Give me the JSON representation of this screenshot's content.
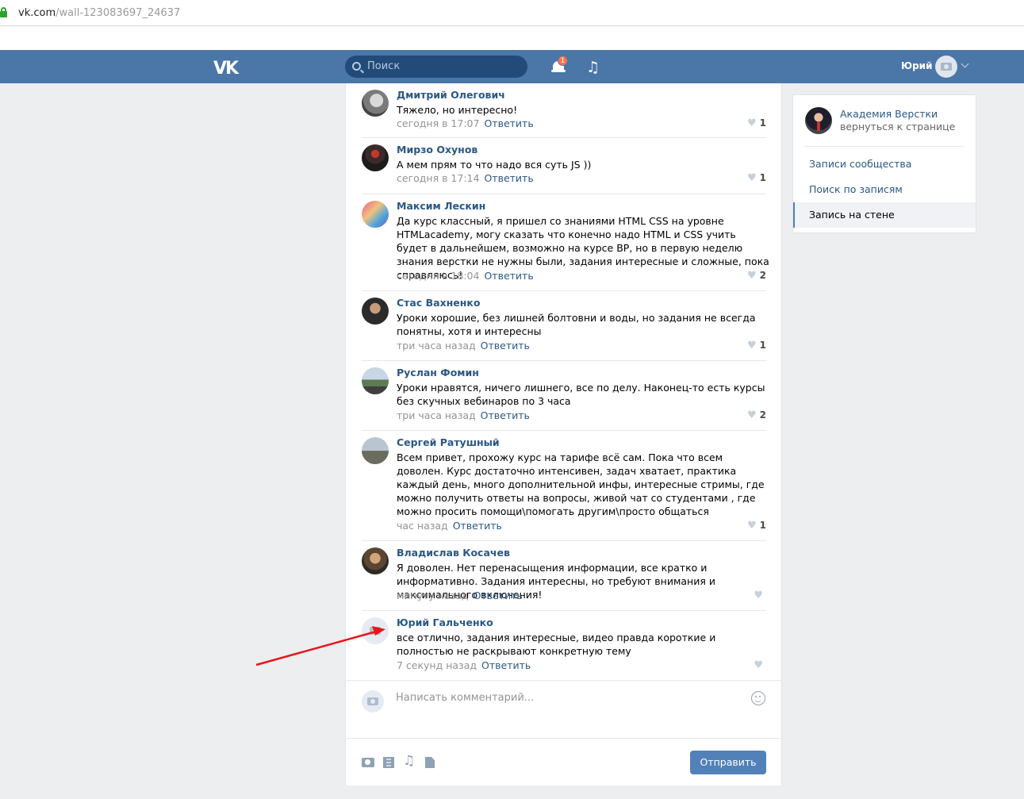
{
  "browser": {
    "url_host": "vk.com",
    "url_path": "/wall-123083697_24637"
  },
  "header": {
    "logo": "VK",
    "search_placeholder": "Поиск",
    "notifications_count": "1",
    "user_name": "Юрий"
  },
  "comments": [
    {
      "author": "Дмитрий Олегович",
      "text": "Тяжело, но интересно!",
      "time": "сегодня в 17:07",
      "reply": "Ответить",
      "likes": "1"
    },
    {
      "author": "Мирзо Охунов",
      "text": "А мем прям то что надо вся суть JS ))",
      "time": "сегодня в 17:14",
      "reply": "Ответить",
      "likes": "1"
    },
    {
      "author": "Максим Лескин",
      "text": "Да курс классный, я пришел со знаниями HTML CSS на уровне HTMLacademy, могу сказать что конечно надо HTML и CSS учить будет в дальнейшем, возможно на курсе ВР, но в первую неделю знания верстки не нужны были, задания интересные и сложные, пока справляюсь!",
      "time": "сегодня в 18:04",
      "reply": "Ответить",
      "likes": "2"
    },
    {
      "author": "Стас Вахненко",
      "text": "Уроки хорошие, без лишней болтовни и воды, но задания не всегда понятны, хотя и интересны",
      "time": "три часа назад",
      "reply": "Ответить",
      "likes": "1"
    },
    {
      "author": "Руслан Фомин",
      "text": "Уроки нравятся, ничего лишнего, все по делу. Наконец-то есть курсы без скучных вебинаров по 3 часа",
      "time": "три часа назад",
      "reply": "Ответить",
      "likes": "2"
    },
    {
      "author": "Сергей Ратушный",
      "text": "Всем привет, прохожу курс на тарифе всё сам. Пока что всем доволен. Курс достаточно интенсивен, задач хватает, практика каждый день, много дополнительной инфы, интересные стримы, где можно получить ответы на вопросы, живой чат со студентами , где можно просить помощи\\помогать другим\\просто общаться",
      "time": "час назад",
      "reply": "Ответить",
      "likes": "1"
    },
    {
      "author": "Владислав Косачев",
      "text": "Я доволен. Нет перенасыщения информации, все кратко и информативно. Задания интересны, но требуют внимания и максимального включения!",
      "time": "минуту назад",
      "reply": "Ответить",
      "likes": ""
    },
    {
      "author": "Юрий Гальченко",
      "text": "все отлично, задания интересные, видео правда короткие и полностью не раскрывают конкретную тему",
      "time": "7 секунд назад",
      "reply": "Ответить",
      "likes": ""
    }
  ],
  "composer": {
    "placeholder": "Написать комментарий...",
    "send_label": "Отправить"
  },
  "sidebar": {
    "group_name": "Академия Верстки",
    "back_link": "вернуться к странице",
    "items": [
      {
        "label": "Записи сообщества",
        "active": false
      },
      {
        "label": "Поиск по записям",
        "active": false
      },
      {
        "label": "Запись на стене",
        "active": true
      }
    ]
  },
  "colors": {
    "header": "#4a76a8",
    "link": "#2a5885",
    "button": "#5181b8",
    "arrow": "#e8151b"
  }
}
